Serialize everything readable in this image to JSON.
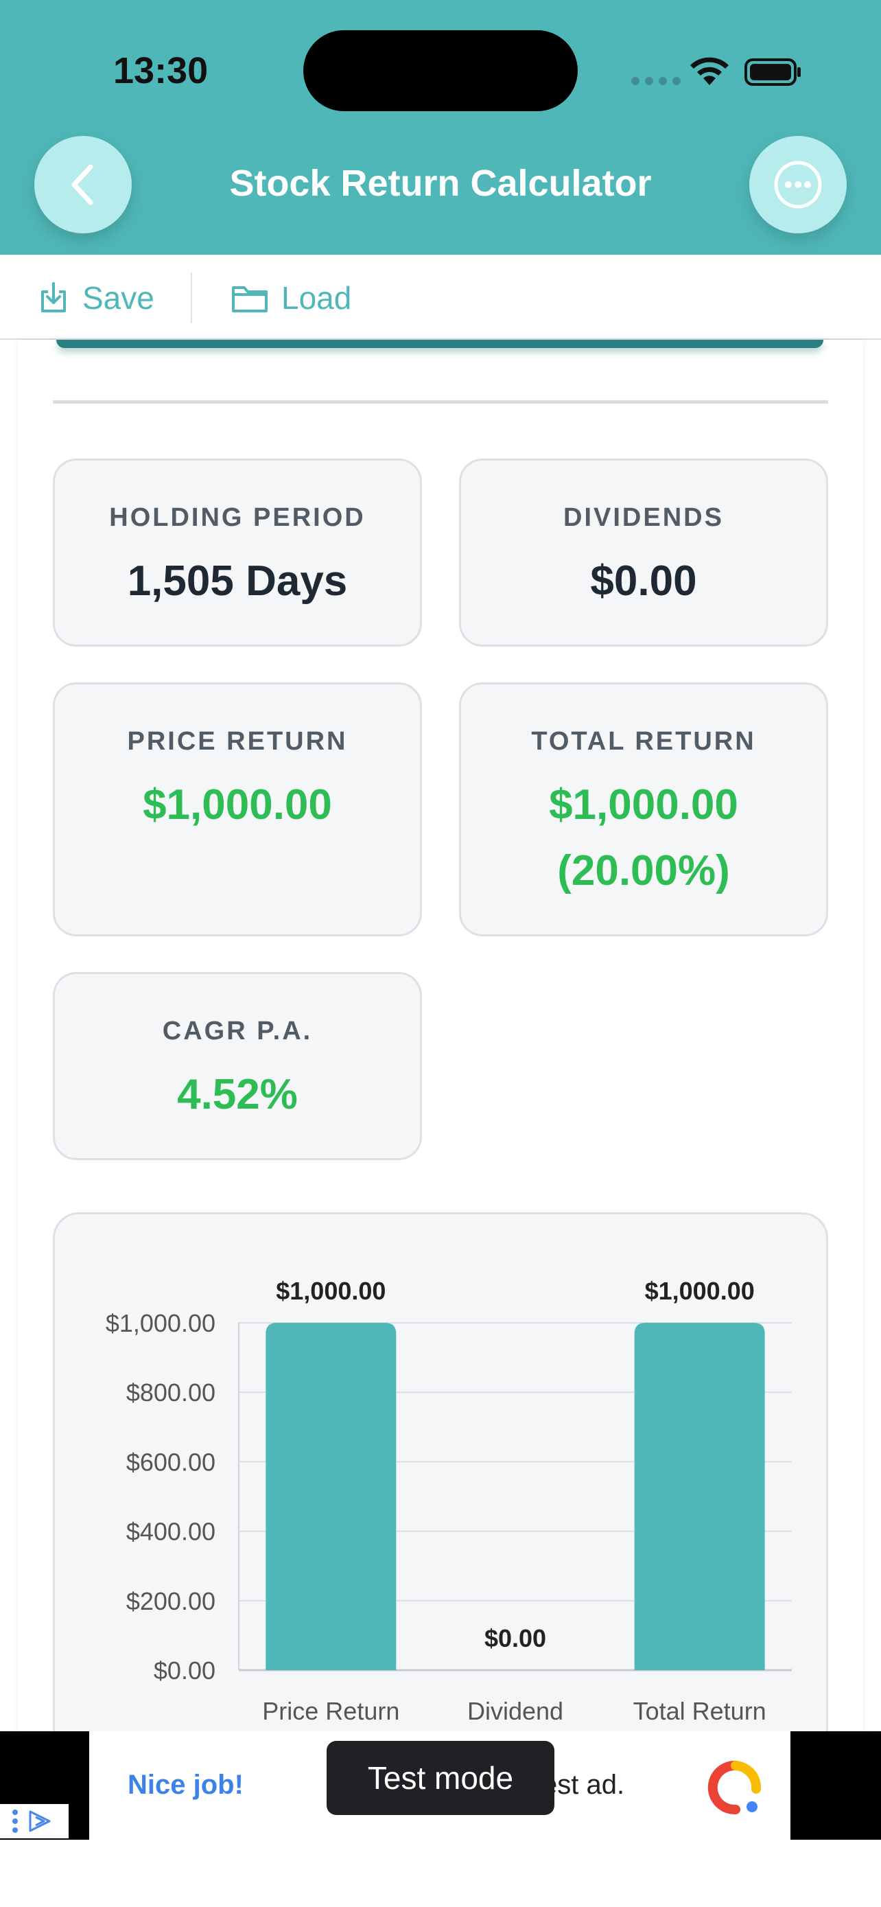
{
  "status_bar": {
    "time": "13:30"
  },
  "header": {
    "title": "Stock Return Calculator"
  },
  "toolbar": {
    "save_label": "Save",
    "load_label": "Load"
  },
  "stats": {
    "holding_period": {
      "label": "HOLDING PERIOD",
      "value": "1,505 Days"
    },
    "dividends": {
      "label": "DIVIDENDS",
      "value": "$0.00"
    },
    "price_return": {
      "label": "PRICE RETURN",
      "value": "$1,000.00"
    },
    "total_return": {
      "label": "TOTAL RETURN",
      "value": "$1,000.00",
      "percent": "(20.00%)"
    },
    "cagr": {
      "label": "CAGR P.A.",
      "value": "4.52%"
    }
  },
  "chart_data": {
    "type": "bar",
    "categories": [
      "Price Return",
      "Dividend",
      "Total Return"
    ],
    "values": [
      1000,
      0,
      1000
    ],
    "value_labels": [
      "$1,000.00",
      "$0.00",
      "$1,000.00"
    ],
    "ylim": [
      0,
      1000
    ],
    "yticks": [
      0,
      200,
      400,
      600,
      800,
      1000
    ],
    "ytick_labels": [
      "$0.00",
      "$200.00",
      "$400.00",
      "$600.00",
      "$800.00",
      "$1,000.00"
    ],
    "grid": true,
    "bar_color": "#4fb7b8"
  },
  "ad": {
    "left_text": "Nice job!",
    "right_text": "est ad.",
    "toast": "Test mode"
  },
  "colors": {
    "accent": "#4fb7b8",
    "positive": "#2ebc55"
  }
}
